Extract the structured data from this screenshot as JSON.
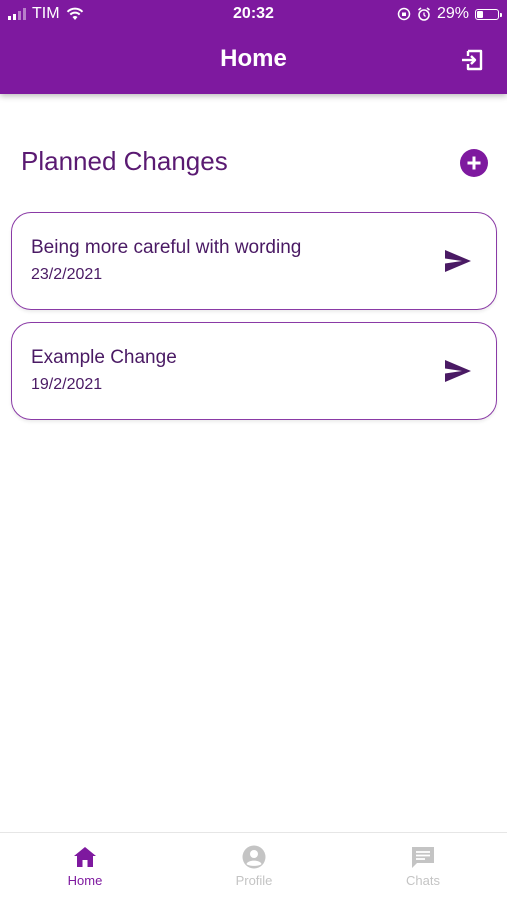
{
  "status_bar": {
    "carrier": "TIM",
    "time": "20:32",
    "battery": "29%",
    "battery_level": 0.29
  },
  "header": {
    "title": "Home"
  },
  "section": {
    "title": "Planned Changes"
  },
  "changes": [
    {
      "title": "Being more careful with wording",
      "date": "23/2/2021"
    },
    {
      "title": "Example Change",
      "date": "19/2/2021"
    }
  ],
  "nav": {
    "home": "Home",
    "profile": "Profile",
    "chats": "Chats"
  },
  "colors": {
    "primary": "#7e199f",
    "text_dark_purple": "#4a1a64",
    "inactive": "#c4c4c4"
  }
}
